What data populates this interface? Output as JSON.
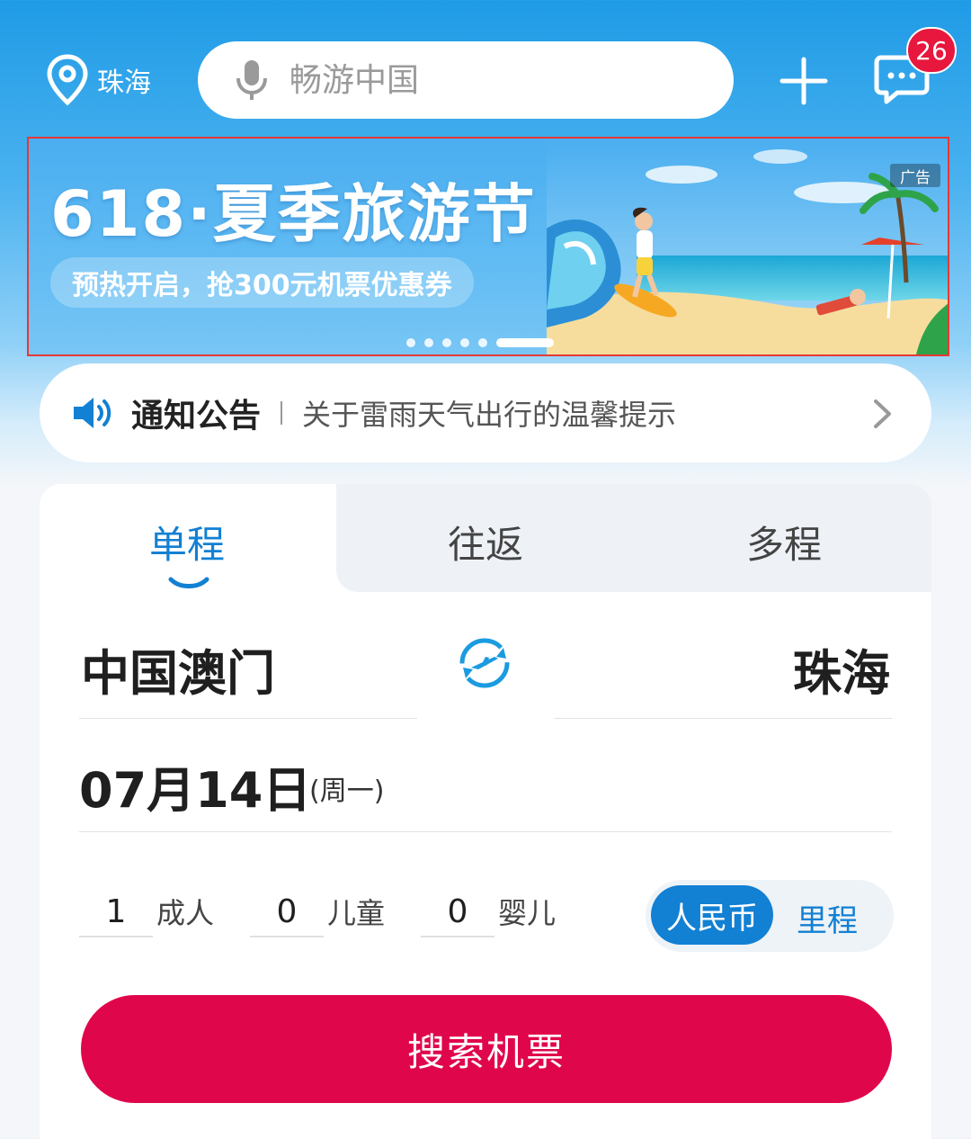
{
  "header": {
    "location_label": "珠海",
    "search_placeholder": "畅游中国",
    "message_count": "26"
  },
  "banner": {
    "title": "618·夏季旅游节",
    "subtitle": "预热开启，抢300元机票优惠券",
    "ad_tag": "广告",
    "slide_count": 6,
    "active_slide": 6
  },
  "notice": {
    "title": "通知公告",
    "text": "关于雷雨天气出行的温馨提示"
  },
  "tabs": [
    {
      "label": "单程",
      "active": true
    },
    {
      "label": "往返",
      "active": false
    },
    {
      "label": "多程",
      "active": false
    }
  ],
  "route": {
    "from": "中国澳门",
    "to": "珠海"
  },
  "date": {
    "value": "07月14日",
    "weekday": "(周一)"
  },
  "passengers": [
    {
      "count": "1",
      "label": "成人"
    },
    {
      "count": "0",
      "label": "儿童"
    },
    {
      "count": "0",
      "label": "婴儿"
    }
  ],
  "currency": {
    "selected": "人民币",
    "other": "里程"
  },
  "search_button": "搜索机票",
  "colors": {
    "brand_blue": "#1280d3",
    "search_red": "#e0064c",
    "badge_red": "#e8173e"
  }
}
